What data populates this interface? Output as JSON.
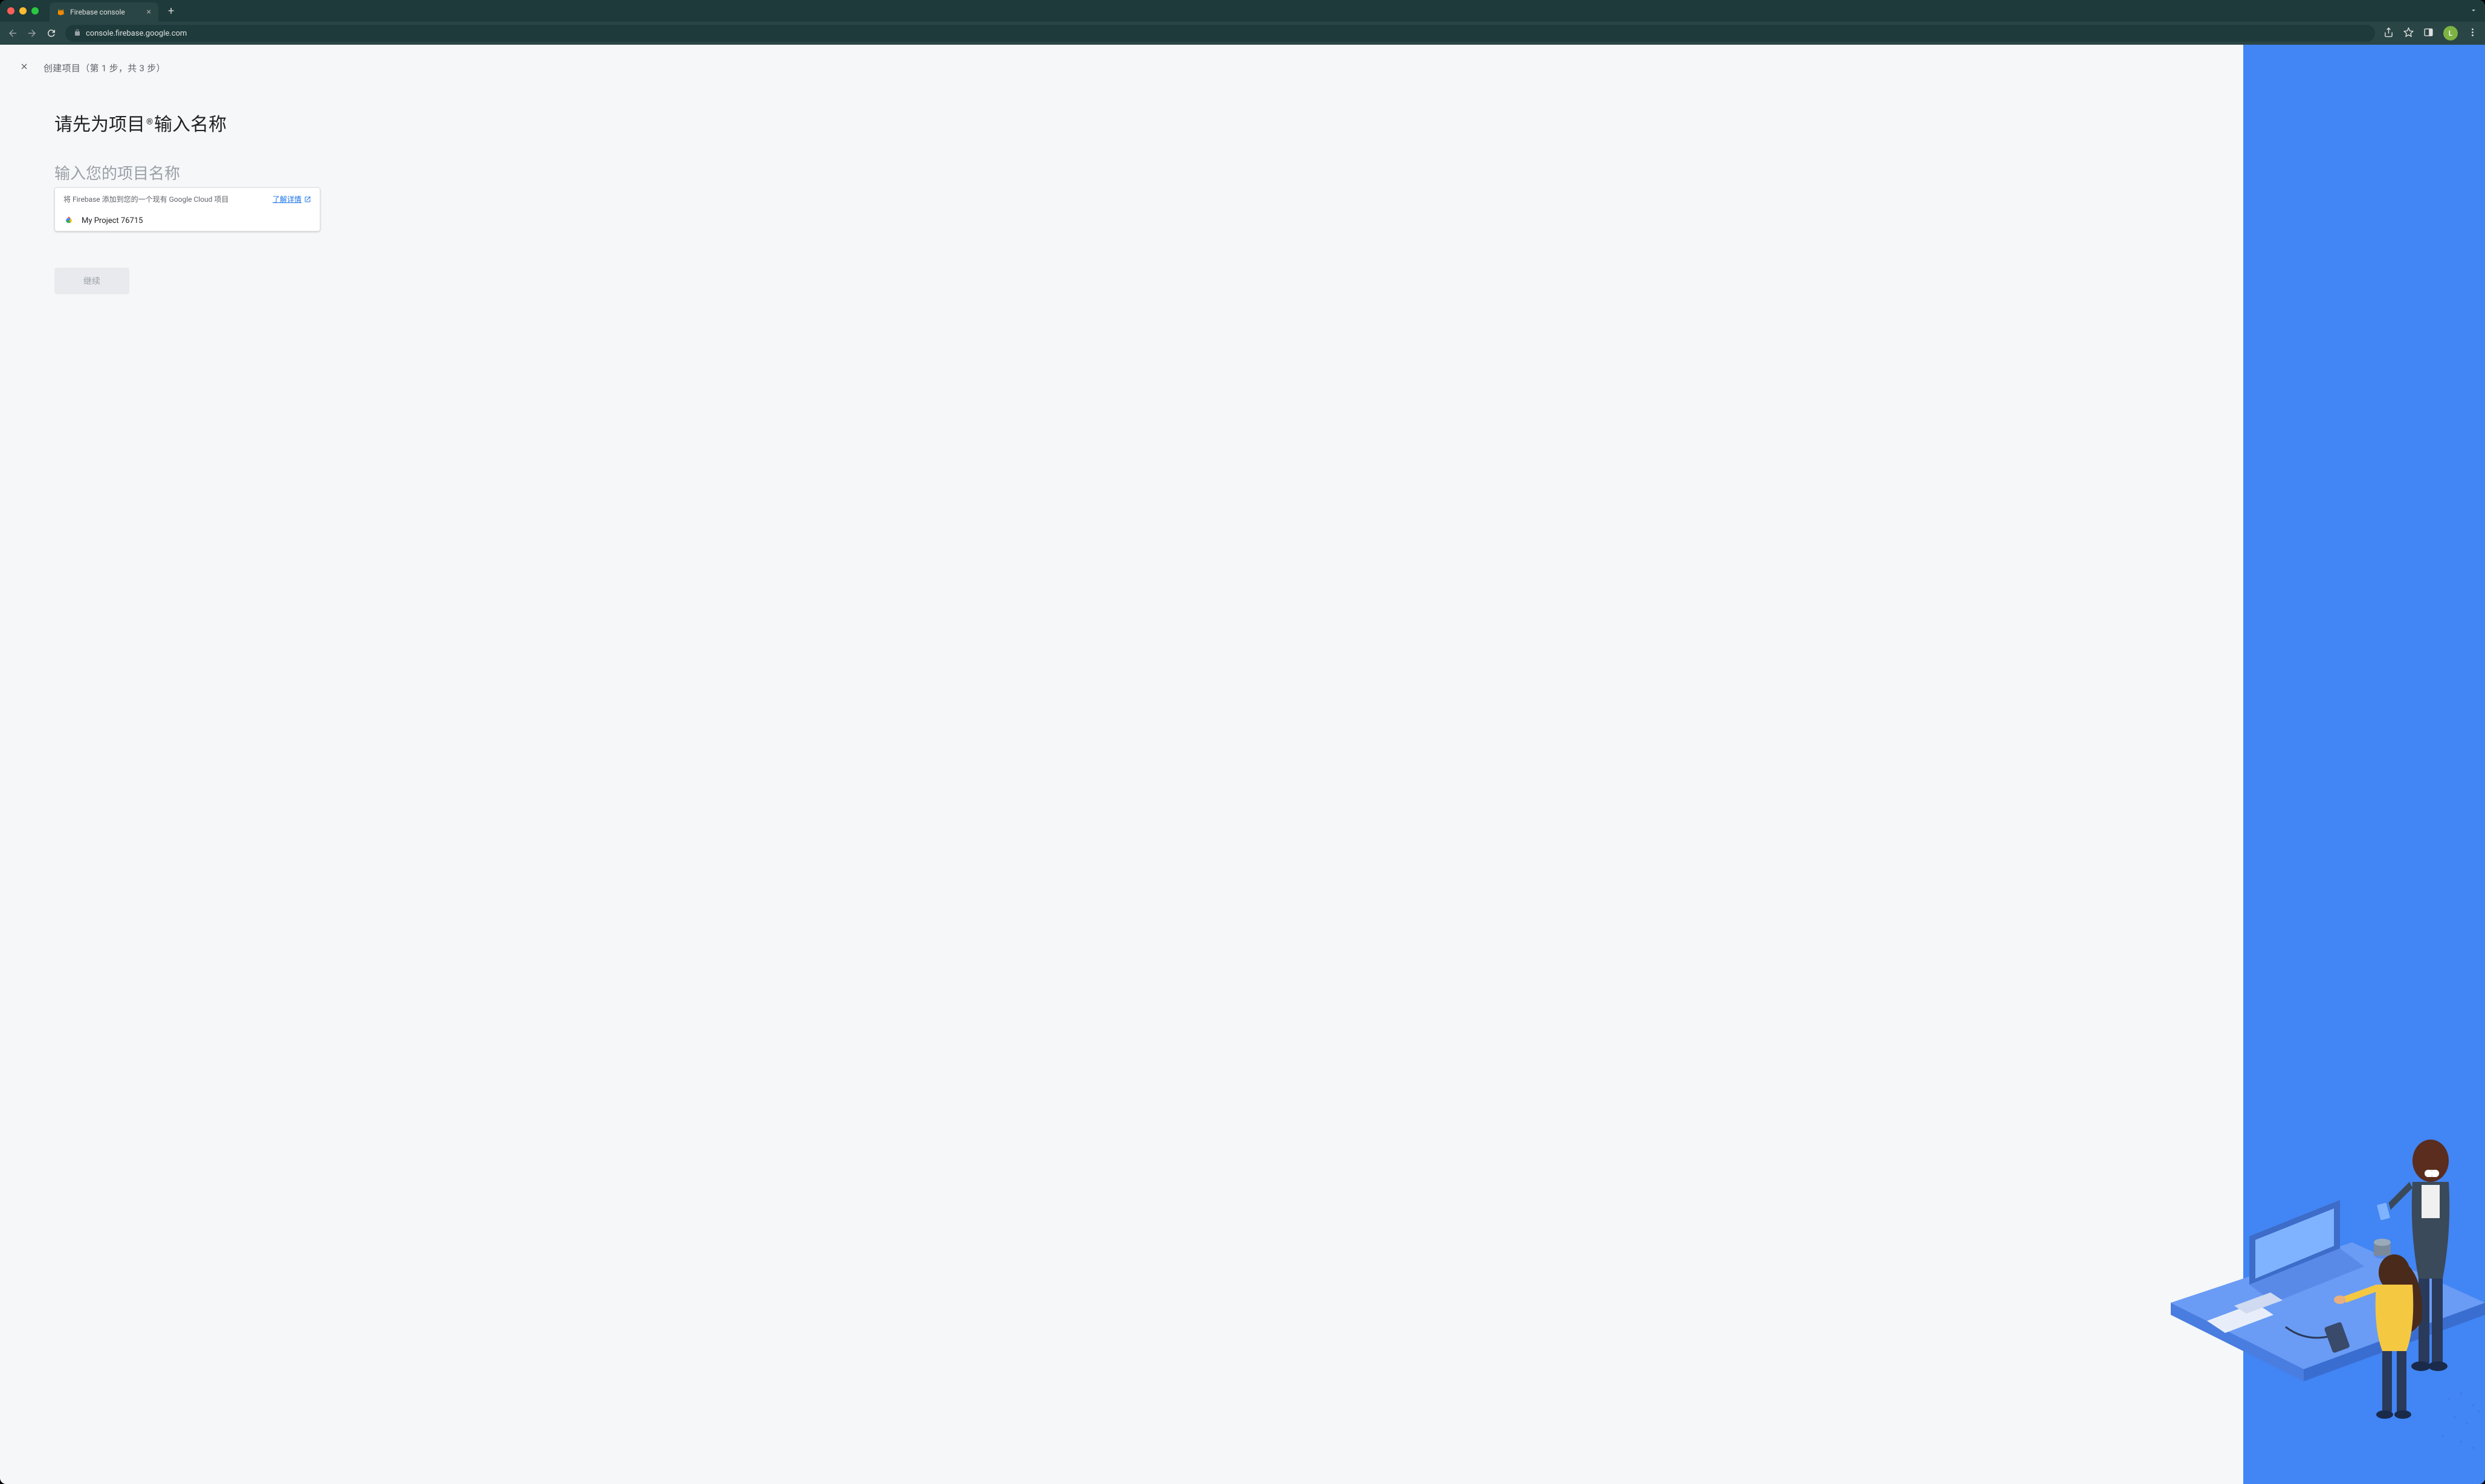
{
  "browser": {
    "tab_title": "Firebase console",
    "url": "console.firebase.google.com",
    "avatar_initial": "L"
  },
  "page": {
    "step_label": "创建项目（第 1 步，共 3 步）",
    "heading_pre": "请先为项目",
    "heading_sup": "®",
    "heading_post": " 输入名称",
    "input_placeholder": "输入您的项目名称",
    "dropdown": {
      "hint": "将 Firebase 添加到您的一个现有 Google Cloud 项目",
      "learn_more": "了解详情",
      "items": [
        {
          "label": "My Project 76715"
        }
      ]
    },
    "continue_label": "继续"
  }
}
